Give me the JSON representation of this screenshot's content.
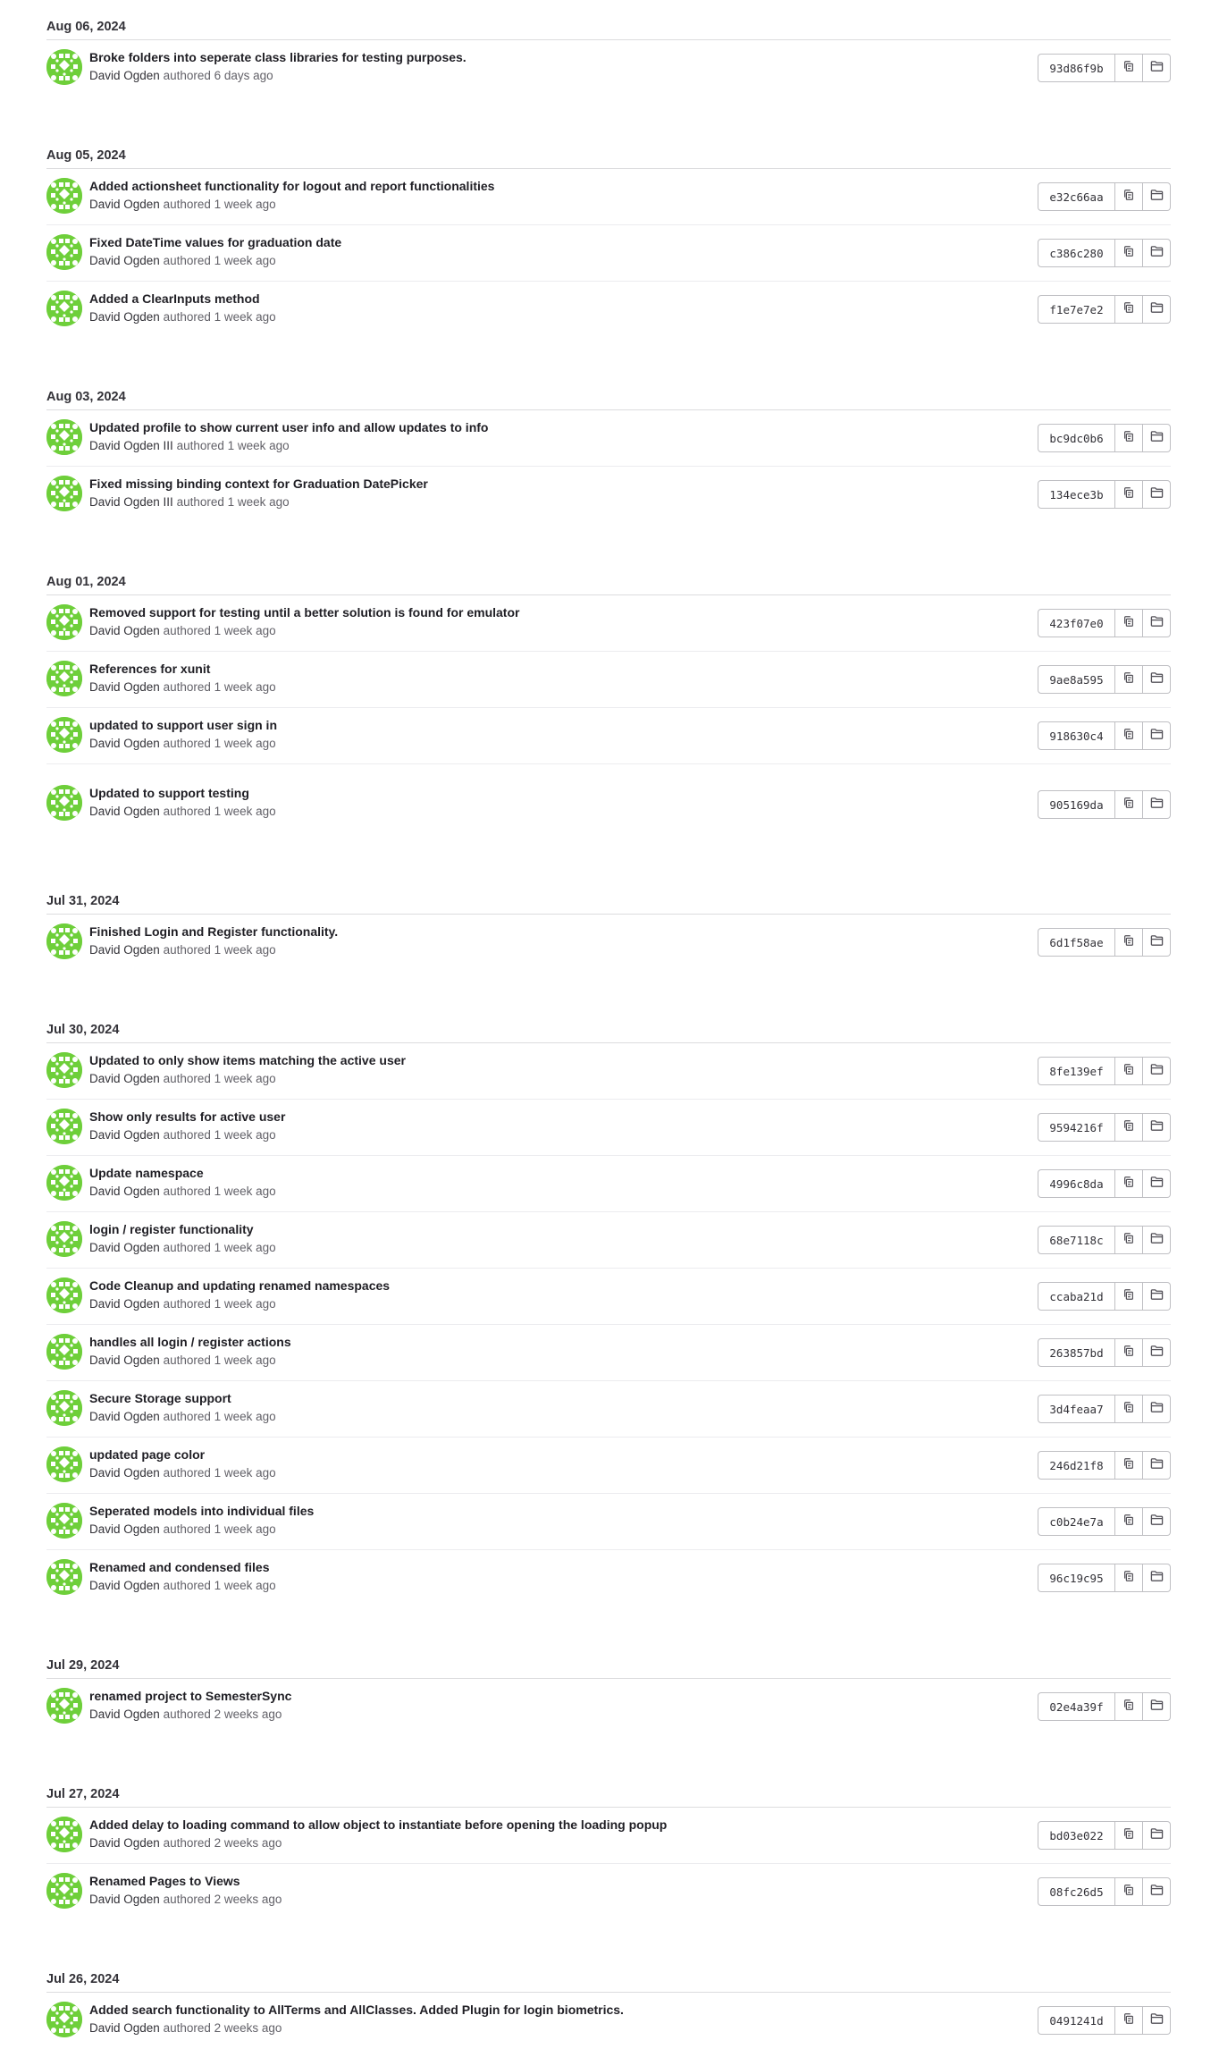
{
  "colors": {
    "avatar_green": "#6ecf3a",
    "border": "#dcdcde",
    "muted": "#626168"
  },
  "days": [
    {
      "date": "Aug 06, 2024",
      "commits": [
        {
          "title": "Broke folders into seperate class libraries for testing purposes.",
          "author": "David Ogden",
          "verb": "authored",
          "time": "6 days ago",
          "sha": "93d86f9b"
        }
      ]
    },
    {
      "date": "Aug 05, 2024",
      "commits": [
        {
          "title": "Added actionsheet functionality for logout and report functionalities",
          "author": "David Ogden",
          "verb": "authored",
          "time": "1 week ago",
          "sha": "e32c66aa"
        },
        {
          "title": "Fixed DateTime values for graduation date",
          "author": "David Ogden",
          "verb": "authored",
          "time": "1 week ago",
          "sha": "c386c280"
        },
        {
          "title": "Added a ClearInputs method",
          "author": "David Ogden",
          "verb": "authored",
          "time": "1 week ago",
          "sha": "f1e7e7e2"
        }
      ]
    },
    {
      "date": "Aug 03, 2024",
      "commits": [
        {
          "title": "Updated profile to show current user info and allow updates to info",
          "author": "David Ogden III",
          "verb": "authored",
          "time": "1 week ago",
          "sha": "bc9dc0b6"
        },
        {
          "title": "Fixed missing binding context for Graduation DatePicker",
          "author": "David Ogden III",
          "verb": "authored",
          "time": "1 week ago",
          "sha": "134ece3b"
        }
      ]
    },
    {
      "date": "Aug 01, 2024",
      "commits": [
        {
          "title": "Removed support for testing until a better solution is found for emulator",
          "author": "David Ogden",
          "verb": "authored",
          "time": "1 week ago",
          "sha": "423f07e0"
        },
        {
          "title": "References for xunit",
          "author": "David Ogden",
          "verb": "authored",
          "time": "1 week ago",
          "sha": "9ae8a595"
        },
        {
          "title": "updated to support user sign in",
          "author": "David Ogden",
          "verb": "authored",
          "time": "1 week ago",
          "sha": "918630c4"
        },
        {
          "title": "Updated to support testing",
          "author": "David Ogden",
          "verb": "authored",
          "time": "1 week ago",
          "sha": "905169da"
        }
      ]
    },
    {
      "date": "Jul 31, 2024",
      "commits": [
        {
          "title": "Finished Login and Register functionality.",
          "author": "David Ogden",
          "verb": "authored",
          "time": "1 week ago",
          "sha": "6d1f58ae"
        }
      ]
    },
    {
      "date": "Jul 30, 2024",
      "commits": [
        {
          "title": "Updated to only show items matching the active user",
          "author": "David Ogden",
          "verb": "authored",
          "time": "1 week ago",
          "sha": "8fe139ef"
        },
        {
          "title": "Show only results for active user",
          "author": "David Ogden",
          "verb": "authored",
          "time": "1 week ago",
          "sha": "9594216f"
        },
        {
          "title": "Update namespace",
          "author": "David Ogden",
          "verb": "authored",
          "time": "1 week ago",
          "sha": "4996c8da"
        },
        {
          "title": "login / register functionality",
          "author": "David Ogden",
          "verb": "authored",
          "time": "1 week ago",
          "sha": "68e7118c"
        },
        {
          "title": "Code Cleanup and updating renamed namespaces",
          "author": "David Ogden",
          "verb": "authored",
          "time": "1 week ago",
          "sha": "ccaba21d"
        },
        {
          "title": "handles all login / register actions",
          "author": "David Ogden",
          "verb": "authored",
          "time": "1 week ago",
          "sha": "263857bd"
        },
        {
          "title": "Secure Storage support",
          "author": "David Ogden",
          "verb": "authored",
          "time": "1 week ago",
          "sha": "3d4feaa7"
        },
        {
          "title": "updated page color",
          "author": "David Ogden",
          "verb": "authored",
          "time": "1 week ago",
          "sha": "246d21f8"
        },
        {
          "title": "Seperated models into individual files",
          "author": "David Ogden",
          "verb": "authored",
          "time": "1 week ago",
          "sha": "c0b24e7a"
        },
        {
          "title": "Renamed and condensed files",
          "author": "David Ogden",
          "verb": "authored",
          "time": "1 week ago",
          "sha": "96c19c95"
        }
      ]
    },
    {
      "date": "Jul 29, 2024",
      "commits": [
        {
          "title": "renamed project to SemesterSync",
          "author": "David Ogden",
          "verb": "authored",
          "time": "2 weeks ago",
          "sha": "02e4a39f"
        }
      ]
    },
    {
      "date": "Jul 27, 2024",
      "commits": [
        {
          "title": "Added delay to loading command to allow object to instantiate before opening the loading popup",
          "author": "David Ogden",
          "verb": "authored",
          "time": "2 weeks ago",
          "sha": "bd03e022"
        },
        {
          "title": "Renamed Pages to Views",
          "author": "David Ogden",
          "verb": "authored",
          "time": "2 weeks ago",
          "sha": "08fc26d5"
        }
      ]
    },
    {
      "date": "Jul 26, 2024",
      "commits": [
        {
          "title": "Added search functionality to AllTerms and AllClasses. Added Plugin for login biometrics.",
          "author": "David Ogden",
          "verb": "authored",
          "time": "2 weeks ago",
          "sha": "0491241d"
        }
      ]
    }
  ]
}
